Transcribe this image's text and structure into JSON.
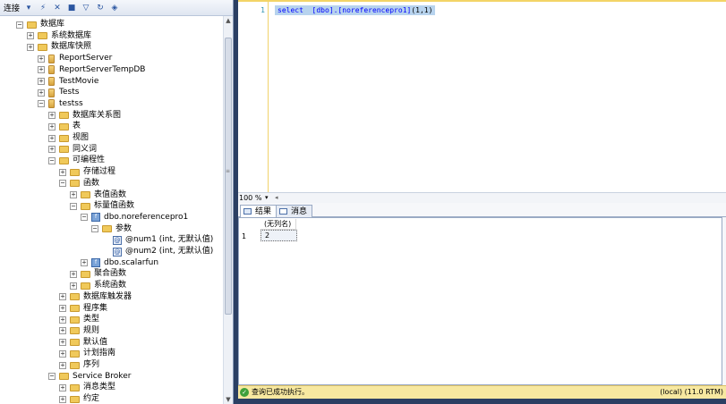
{
  "object_explorer": {
    "toolbar": {
      "connect_label": "连接",
      "connect_dropdown": "▾"
    },
    "tree": [
      {
        "label": "数据库",
        "icon": "folder",
        "expander": "⊟"
      },
      {
        "label": "系统数据库",
        "icon": "folder",
        "expander": "⊞"
      },
      {
        "label": "数据库快照",
        "icon": "folder",
        "expander": "⊞"
      },
      {
        "label": "ReportServer",
        "icon": "database",
        "expander": "⊞"
      },
      {
        "label": "ReportServerTempDB",
        "icon": "database",
        "expander": "⊞"
      },
      {
        "label": "TestMovie",
        "icon": "database",
        "expander": "⊞"
      },
      {
        "label": "Tests",
        "icon": "database",
        "expander": "⊞"
      },
      {
        "label": "testss",
        "icon": "database",
        "expander": "⊟"
      },
      {
        "label": "数据库关系图",
        "icon": "folder",
        "expander": "⊞"
      },
      {
        "label": "表",
        "icon": "folder",
        "expander": "⊞"
      },
      {
        "label": "视图",
        "icon": "folder",
        "expander": "⊞"
      },
      {
        "label": "同义词",
        "icon": "folder",
        "expander": "⊞"
      },
      {
        "label": "可编程性",
        "icon": "folder",
        "expander": "⊟"
      },
      {
        "label": "存储过程",
        "icon": "folder",
        "expander": "⊞"
      },
      {
        "label": "函数",
        "icon": "folder",
        "expander": "⊟"
      },
      {
        "label": "表值函数",
        "icon": "folder",
        "expander": "⊞"
      },
      {
        "label": "标量值函数",
        "icon": "folder",
        "expander": "⊟"
      },
      {
        "label": "dbo.noreferencepro1",
        "icon": "function",
        "expander": "⊟"
      },
      {
        "label": "参数",
        "icon": "folder",
        "expander": "⊟"
      },
      {
        "label": "@num1 (int, 无默认值)",
        "icon": "parameter",
        "expander": ""
      },
      {
        "label": "@num2 (int, 无默认值)",
        "icon": "parameter",
        "expander": ""
      },
      {
        "label": "dbo.scalarfun",
        "icon": "function",
        "expander": "⊞"
      },
      {
        "label": "聚合函数",
        "icon": "folder",
        "expander": "⊞"
      },
      {
        "label": "系统函数",
        "icon": "folder",
        "expander": "⊞"
      },
      {
        "label": "数据库触发器",
        "icon": "folder",
        "expander": "⊞"
      },
      {
        "label": "程序集",
        "icon": "folder",
        "expander": "⊞"
      },
      {
        "label": "类型",
        "icon": "folder",
        "expander": "⊞"
      },
      {
        "label": "规则",
        "icon": "folder",
        "expander": "⊞"
      },
      {
        "label": "默认值",
        "icon": "folder",
        "expander": "⊞"
      },
      {
        "label": "计划指南",
        "icon": "folder",
        "expander": "⊞"
      },
      {
        "label": "序列",
        "icon": "folder",
        "expander": "⊞"
      },
      {
        "label": "Service Broker",
        "icon": "folder",
        "expander": "⊟"
      },
      {
        "label": "消息类型",
        "icon": "folder",
        "expander": "⊞"
      },
      {
        "label": "约定",
        "icon": "folder",
        "expander": "⊞"
      }
    ]
  },
  "editor": {
    "line_number": "1",
    "sql": {
      "keyword": "select",
      "object": "[dbo].[noreferencepro1]",
      "args": "(1,1)"
    }
  },
  "zoom": {
    "value": "100 %",
    "dropdown": "▾",
    "divider": "◂"
  },
  "results": {
    "tabs": [
      {
        "label": "结果",
        "active": true
      },
      {
        "label": "消息",
        "active": false
      }
    ],
    "grid": {
      "column_header": "(无列名)",
      "rows": [
        {
          "row_number": "1",
          "value": "2"
        }
      ]
    }
  },
  "status": {
    "message": "查询已成功执行。",
    "server": "(local) (11.0 RTM)"
  },
  "colors": {
    "status_bar": "#f7e8a0",
    "editor_border": "#f3d467",
    "selection": "#b7d3ee",
    "shell": "#2b3f63"
  }
}
